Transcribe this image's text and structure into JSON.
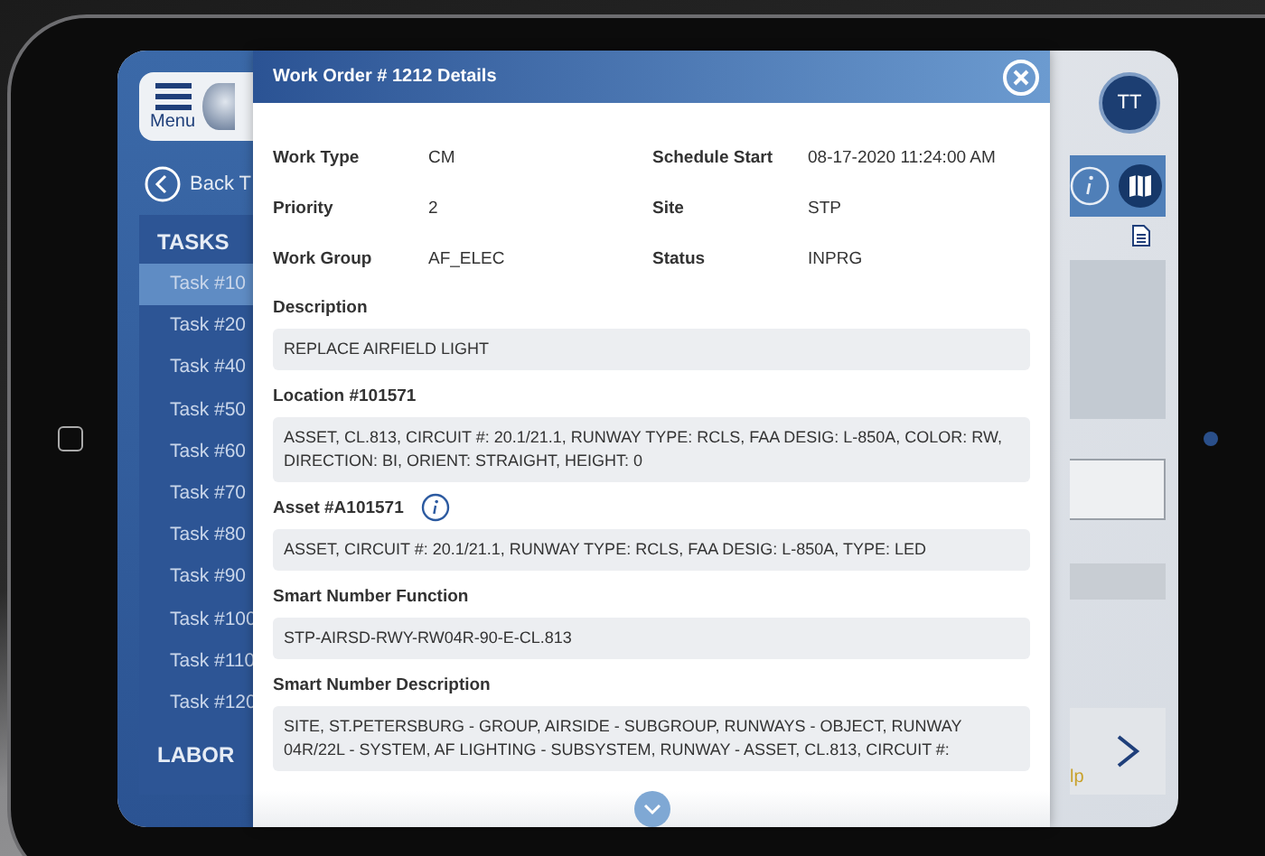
{
  "sidebar": {
    "menu_label": "Menu",
    "back_label": "Back T",
    "tasks_heading": "TASKS",
    "tasks": [
      {
        "label": "Task #10",
        "selected": true
      },
      {
        "label": "Task #20",
        "selected": false
      },
      {
        "label": "Task #40",
        "selected": false
      },
      {
        "label": "Task #50",
        "selected": false
      },
      {
        "label": "Task #60",
        "selected": false
      },
      {
        "label": "Task #70",
        "selected": false
      },
      {
        "label": "Task #80",
        "selected": false
      },
      {
        "label": "Task #90",
        "selected": false
      },
      {
        "label": "Task #100",
        "selected": false
      },
      {
        "label": "Task #110",
        "selected": false
      },
      {
        "label": "Task #120",
        "selected": false
      }
    ],
    "labor_heading": "LABOR"
  },
  "header": {
    "avatar": "TT"
  },
  "footer": {
    "help_fragment": "lp"
  },
  "modal": {
    "title": "Work Order # 1212 Details",
    "details": [
      {
        "label": "Work Type",
        "value": "CM"
      },
      {
        "label": "Schedule Start",
        "value": "08-17-2020 11:24:00 AM"
      },
      {
        "label": "Priority",
        "value": "2"
      },
      {
        "label": "Site",
        "value": "STP"
      },
      {
        "label": "Work Group",
        "value": "AF_ELEC"
      },
      {
        "label": "Status",
        "value": "INPRG"
      }
    ],
    "sections": [
      {
        "label": "Description",
        "kind": "plain",
        "value": "REPLACE AIRFIELD LIGHT"
      },
      {
        "label": "Location #101571",
        "kind": "plain",
        "value": "ASSET, CL.813, CIRCUIT #: 20.1/21.1, RUNWAY TYPE: RCLS, FAA DESIG: L-850A, COLOR: RW, DIRECTION: BI, ORIENT: STRAIGHT, HEIGHT: 0"
      },
      {
        "label": "Asset #A101571",
        "kind": "info",
        "value": "ASSET, CIRCUIT #: 20.1/21.1, RUNWAY TYPE: RCLS, FAA DESIG: L-850A, TYPE: LED"
      },
      {
        "label": "Smart Number Function",
        "kind": "plain",
        "value": "STP-AIRSD-RWY-RW04R-90-E-CL.813"
      },
      {
        "label": "Smart Number Description",
        "kind": "plain",
        "value": "SITE, ST.PETERSBURG - GROUP, AIRSIDE - SUBGROUP, RUNWAYS - OBJECT, RUNWAY 04R/22L - SYSTEM, AF LIGHTING - SUBSYSTEM, RUNWAY - ASSET, CL.813, CIRCUIT #:"
      }
    ]
  }
}
